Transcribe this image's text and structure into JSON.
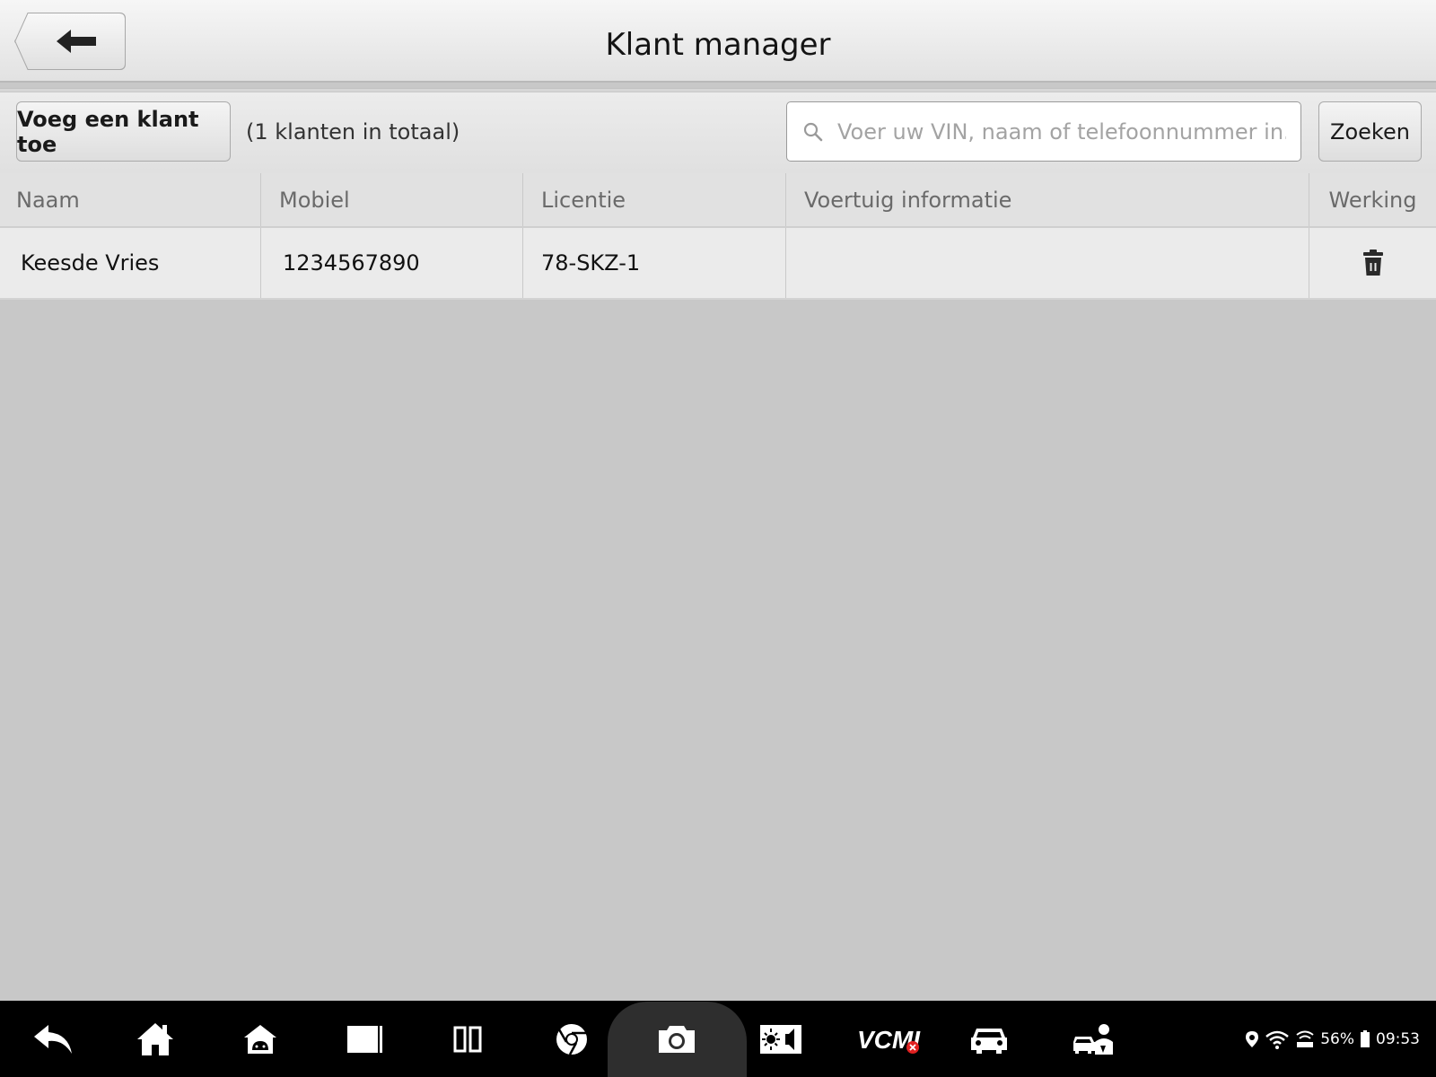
{
  "header": {
    "title": "Klant manager"
  },
  "toolbar": {
    "add_label": "Voeg een klant toe",
    "total_text": "(1 klanten in totaal)",
    "search_placeholder": "Voer uw VIN, naam of telefoonnummer in.",
    "search_value": "",
    "search_label": "Zoeken"
  },
  "table": {
    "columns": [
      "Naam",
      "Mobiel",
      "Licentie",
      "Voertuig informatie",
      "Werking"
    ],
    "rows": [
      {
        "name": "Keesde Vries",
        "mobile": "1234567890",
        "license": "78-SKZ-1",
        "vehicle": ""
      }
    ]
  },
  "navbar": {
    "icons": [
      "back-icon",
      "home-icon",
      "android-home-icon",
      "recent-apps-icon",
      "split-screen-icon",
      "chrome-icon",
      "camera-icon",
      "display-volume-icon",
      "vcmi-icon",
      "car-icon",
      "car-service-icon"
    ],
    "vcmi_label": "VCMI"
  },
  "status": {
    "battery": "56%",
    "time": "09:53"
  },
  "colors": {
    "background": "#c8c8c8",
    "navbar": "#000000",
    "alert_red": "#e02020"
  }
}
